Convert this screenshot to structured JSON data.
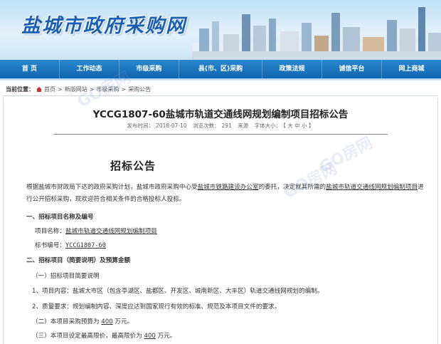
{
  "header": {
    "logo_text": "盐城市政府采购网"
  },
  "nav": {
    "items": [
      "首 页",
      "工作动态",
      "市级采购",
      "县(市、区)采购",
      "政策法规",
      "诚信平台",
      "网上商城"
    ]
  },
  "breadcrumb": {
    "label": "当前位置：",
    "items": [
      "首页",
      "新版网站",
      "市级采购",
      "采购公告"
    ],
    "separator": ">"
  },
  "article": {
    "title": "YCCG1807-60盐城市轨道交通线网规划编制项目招标公告",
    "meta": {
      "publish_label": "发布时间：",
      "publish_date": "2018-07-10",
      "views_label": "浏览次数：",
      "views": "291",
      "source_label": "来源",
      "font_label": "字体大小：",
      "font_sizes": "【 大 中 小 】"
    },
    "heading": "招标公告",
    "intro_1": "根据盐城市财政局下达的政府采购计划，盐城市政府采购中心受",
    "intro_client": "盐城市铁路建设办公室",
    "intro_2": "的委托，决定就其所需的",
    "intro_project": "盐城市轨道交通线网规划编制项目",
    "intro_3": "进行公开招标采购，现欢迎符合相关条件的合格投标人投标。",
    "sec1_title": "一、招标项目名称及编号",
    "project_name_label": "项目名称：",
    "project_name": "盐城市轨道交通线网规划编制项目",
    "bid_no_label": "标书编号：",
    "bid_no": "YCCG1807-60",
    "sec2_title": "二、招标项目（简要说明）及预算金额",
    "sub1": "（一）招标项目简要说明",
    "item1": "1、项目内容：盐城大市区（包含亭湖区、盐都区、开发区、城南新区、大丰区）轨道交通线网规划的编制。",
    "item2": "2、质量要求：规划编制内容、深度应达到国家现行有效的标准、规范及本项目文件的要求。",
    "budget_1": "（二）本项目采购预算为",
    "budget_value": "400",
    "budget_2": "万元。",
    "ceiling_1": "（三）本项目设定最高限价，最高限价为",
    "ceiling_value": "400",
    "ceiling_2": "万元。"
  },
  "watermarks": [
    "GO房网",
    "GO房网",
    "GO房网"
  ]
}
